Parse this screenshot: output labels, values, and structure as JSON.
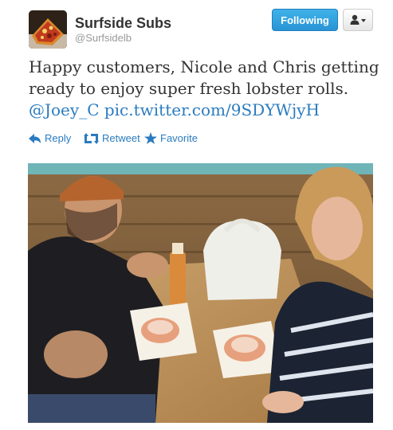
{
  "account": {
    "display_name": "Surfside Subs",
    "username": "@Surfsidelb",
    "avatar_icon": "pizza-avatar"
  },
  "header": {
    "follow_label": "Following",
    "user_menu_icon": "user-dropdown-icon"
  },
  "tweet": {
    "line1": "Happy customers, Nicole and Chris getting",
    "line2": "ready to enjoy super fresh lobster rolls.",
    "mention": "@Joey_C",
    "link": "pic.twitter.com/9SDYWjyH"
  },
  "actions": {
    "reply": "Reply",
    "retweet": "Retweet",
    "favorite": "Favorite"
  },
  "colors": {
    "link": "#2a7bbf",
    "follow_button": "#2a94d6"
  },
  "photo": {
    "icon": "attached-photo"
  }
}
